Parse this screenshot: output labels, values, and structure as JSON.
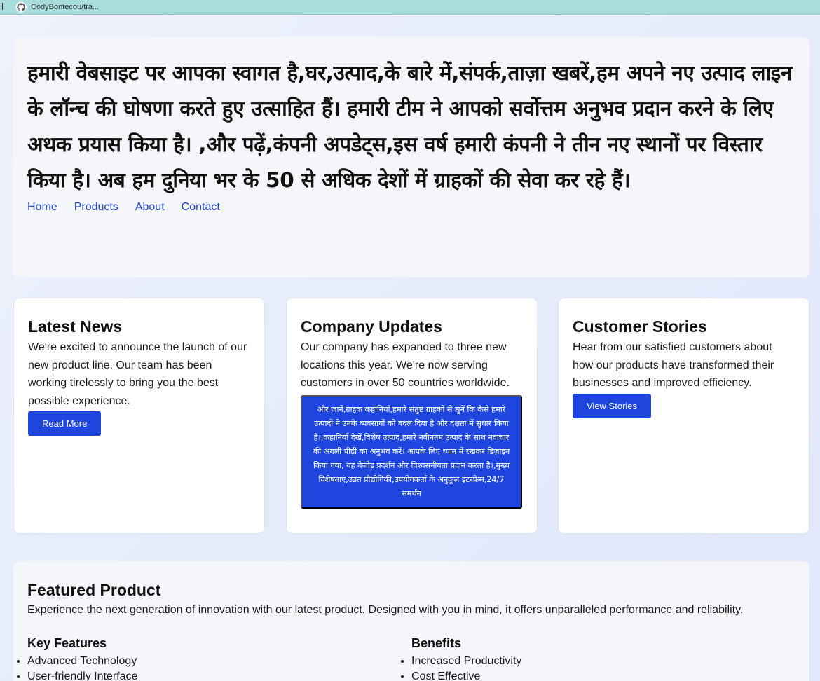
{
  "browser": {
    "tab_title": "CodyBontecou/tra..."
  },
  "hero": {
    "title": "हमारी वेबसाइट पर आपका स्वागत है,घर,उत्पाद,के बारे में,संपर्क,ताज़ा खबरें,हम अपने नए उत्पाद लाइन के लॉन्च की घोषणा करते हुए उत्साहित हैं। हमारी टीम ने आपको सर्वोत्तम अनुभव प्रदान करने के लिए अथक प्रयास किया है। ,और पढ़ें,कंपनी अपडेट्स,इस वर्ष हमारी कंपनी ने तीन नए स्थानों पर विस्तार किया है। अब हम दुनिया भर के 50 से अधिक देशों में ग्राहकों की सेवा कर रहे हैं।",
    "nav": [
      "Home",
      "Products",
      "About",
      "Contact"
    ]
  },
  "cards": [
    {
      "title": "Latest News",
      "text": "We're excited to announce the launch of our new product line. Our team has been working tirelessly to bring you the best possible experience.",
      "button": "Read More"
    },
    {
      "title": "Company Updates",
      "text": "Our company has expanded to three new locations this year. We're now serving customers in over 50 countries worldwide.",
      "button": "और जानें,ग्राहक कहानियाँ,हमारे संतुष्ट ग्राहकों से सुनें कि कैसे हमारे उत्पादों ने उनके व्यवसायों को बदल दिया है और दक्षता में सुधार किया है।,कहानियाँ देखें,विशेष उत्पाद,हमारे नवीनतम उत्पाद के साथ नवाचार की अगली पीढ़ी का अनुभव करें। आपके लिए ध्यान में रखकर डिज़ाइन किया गया, यह बेजोड़ प्रदर्शन और विश्वसनीयता प्रदान करता है।,मुख्य विशेषताएं,उन्नत प्रौद्योगिकी,उपयोगकर्ता के अनुकूल इंटरफ़ेस,24/7 समर्थन"
    },
    {
      "title": "Customer Stories",
      "text": "Hear from our satisfied customers about how our products have transformed their businesses and improved efficiency.",
      "button": "View Stories"
    }
  ],
  "featured": {
    "title": "Featured Product",
    "description": "Experience the next generation of innovation with our latest product. Designed with you in mind, it offers unparalleled performance and reliability.",
    "features_heading": "Key Features",
    "features": [
      "Advanced Technology",
      "User-friendly Interface"
    ],
    "benefits_heading": "Benefits",
    "benefits": [
      "Increased Productivity",
      "Cost Effective"
    ]
  }
}
